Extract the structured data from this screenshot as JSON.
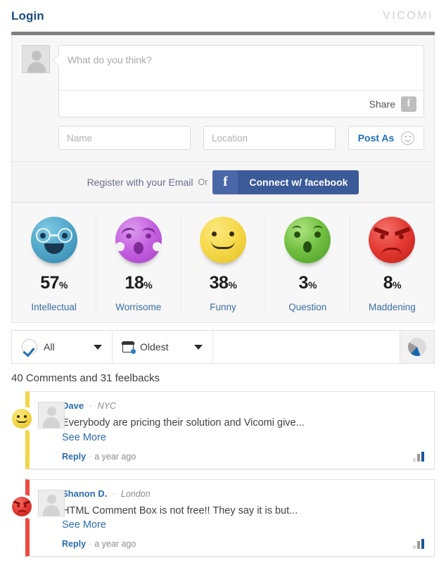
{
  "header": {
    "login_label": "Login",
    "brand": "VICOMI"
  },
  "composer": {
    "placeholder": "What do you think?",
    "value": "",
    "share_label": "Share",
    "facebook_glyph": "f",
    "name_placeholder": "Name",
    "name_value": "",
    "location_placeholder": "Location",
    "location_value": "",
    "post_as_label": "Post As"
  },
  "register": {
    "email_label": "Register with your Email",
    "or_label": "Or",
    "facebook_glyph": "f",
    "facebook_label": "Connect w/ facebook"
  },
  "emotions": [
    {
      "name": "Intellectual",
      "percent": "57",
      "unit": "%",
      "color": "#53a8ca"
    },
    {
      "name": "Worrisome",
      "percent": "18",
      "unit": "%",
      "color": "#c461e0"
    },
    {
      "name": "Funny",
      "percent": "38",
      "unit": "%",
      "color": "#f5d94b"
    },
    {
      "name": "Question",
      "percent": "3",
      "unit": "%",
      "color": "#71c040"
    },
    {
      "name": "Maddening",
      "percent": "8",
      "unit": "%",
      "color": "#e33a33"
    }
  ],
  "filterbar": {
    "filter_label": "All",
    "sort_label": "Oldest"
  },
  "counts_text": "40 Comments and 31 feelbacks",
  "comments": [
    {
      "author": "Dave",
      "separator": "·",
      "location": "NYC",
      "text": "Everybody are pricing their solution and Vicomi give...",
      "see_more": "See More",
      "reply": "Reply",
      "time": "a year ago",
      "emotion": "Funny",
      "accent": "#f3d548"
    },
    {
      "author": "Shanon D.",
      "separator": "·",
      "location": "London",
      "text": "HTML Comment Box is not free!! They say it is but...",
      "see_more": "See More",
      "reply": "Reply",
      "time": "a year ago",
      "emotion": "Maddening",
      "accent": "#ec4b42"
    }
  ]
}
